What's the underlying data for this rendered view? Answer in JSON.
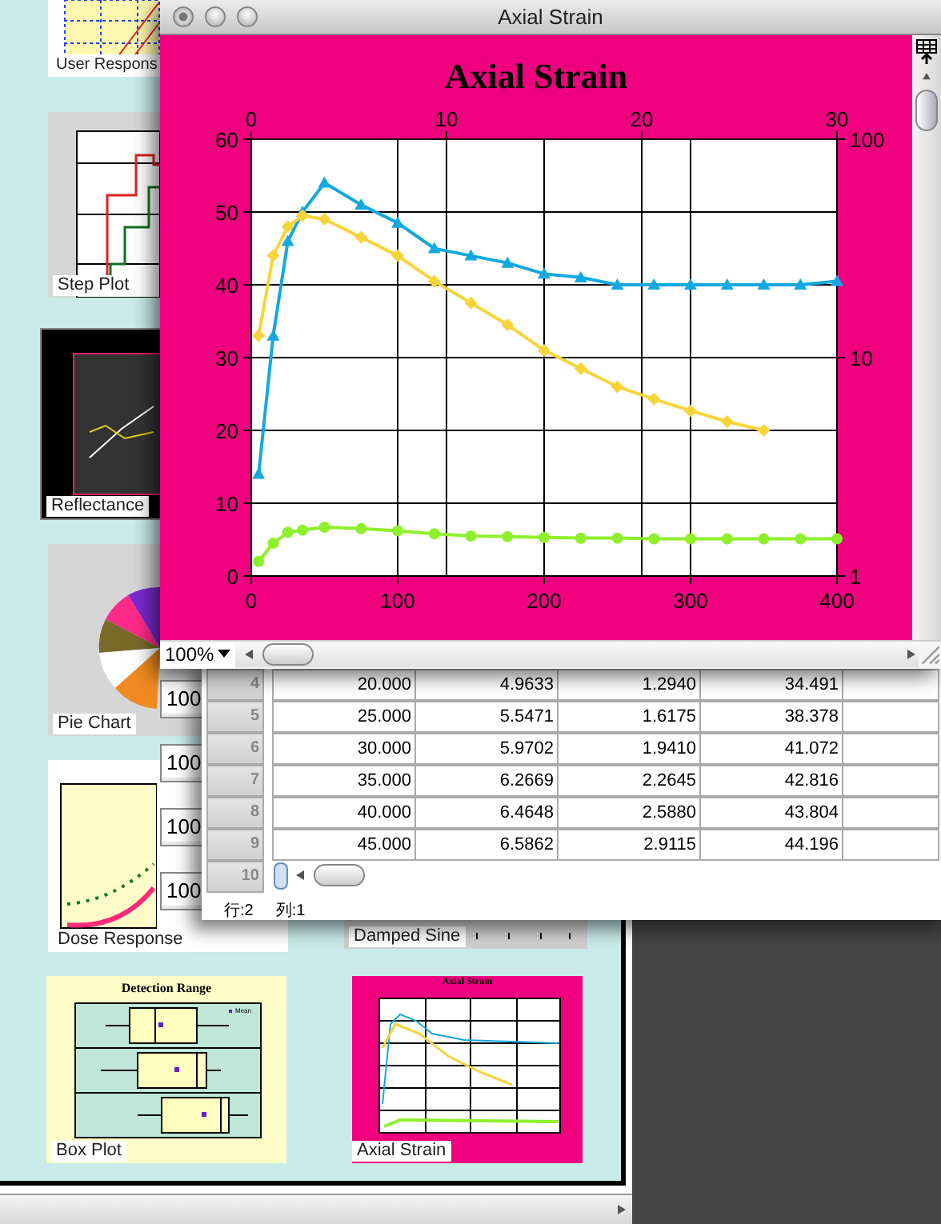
{
  "gallery": {
    "thumbnails": [
      {
        "kind": "grid",
        "label": "User Respons"
      },
      {
        "kind": "step",
        "label": "Step Plot"
      },
      {
        "kind": "dark",
        "label": "Reflectance"
      },
      {
        "kind": "pie",
        "label": "Pie Chart"
      },
      {
        "kind": "dose",
        "label": "Dose Response"
      },
      {
        "kind": "sine",
        "label": "Damped Sine"
      },
      {
        "kind": "box",
        "label": "Box Plot",
        "title": "Detection Range",
        "legend": "Mean"
      },
      {
        "kind": "strain",
        "label": "Axial Strain",
        "title": "Axial Strain"
      }
    ]
  },
  "stacked_windows": [
    {
      "zoom": "100"
    },
    {
      "zoom": "100"
    },
    {
      "zoom": "100"
    },
    {
      "zoom": "100"
    }
  ],
  "table_window": {
    "rows": [
      {
        "number": "4",
        "cells": [
          "20.000",
          "4.9633",
          "1.2940",
          "34.491"
        ]
      },
      {
        "number": "5",
        "cells": [
          "25.000",
          "5.5471",
          "1.6175",
          "38.378"
        ]
      },
      {
        "number": "6",
        "cells": [
          "30.000",
          "5.9702",
          "1.9410",
          "41.072"
        ]
      },
      {
        "number": "7",
        "cells": [
          "35.000",
          "6.2669",
          "2.2645",
          "42.816"
        ]
      },
      {
        "number": "8",
        "cells": [
          "40.000",
          "6.4648",
          "2.5880",
          "43.804"
        ]
      },
      {
        "number": "9",
        "cells": [
          "45.000",
          "6.5862",
          "2.9115",
          "44.196"
        ]
      },
      {
        "number": "10",
        "cells": []
      }
    ],
    "status": [
      "行:2",
      "列:1"
    ]
  },
  "chart_window": {
    "title": "Axial Strain",
    "zoom": "100%",
    "top_axis_labels": [
      "0",
      "10",
      "20",
      "30"
    ],
    "right_axis_labels": [
      "100",
      "10",
      "1"
    ],
    "chart_data": {
      "type": "line",
      "title": "Axial Strain",
      "grid": true,
      "x": [
        5,
        15,
        25,
        35,
        50,
        75,
        100,
        125,
        150,
        175,
        200,
        225,
        250,
        275,
        300,
        325,
        350,
        375,
        400
      ],
      "xlim": [
        0,
        400
      ],
      "ylim": [
        0,
        60
      ],
      "xticks": [
        0,
        100,
        200,
        300,
        400
      ],
      "yticks": [
        0,
        10,
        20,
        30,
        40,
        50,
        60
      ],
      "series": [
        {
          "color": "#12a8e0",
          "marker": "triangle",
          "values": [
            14,
            33,
            46,
            50,
            54,
            51,
            48.5,
            45,
            44,
            43,
            41.5,
            41,
            40,
            40,
            40,
            40,
            40,
            40,
            40.5
          ]
        },
        {
          "color": "#f7d43a",
          "marker": "diamond",
          "values": [
            33,
            44,
            48,
            49.5,
            49,
            46.5,
            44,
            40.5,
            37.5,
            34.5,
            31,
            28.5,
            26,
            24.3,
            22.7,
            21.2,
            20,
            null,
            null
          ]
        },
        {
          "color": "#8ef02a",
          "marker": "circle",
          "values": [
            2,
            4.5,
            6,
            6.3,
            6.7,
            6.5,
            6.2,
            5.8,
            5.5,
            5.4,
            5.3,
            5.2,
            5.2,
            5.1,
            5.1,
            5.1,
            5.1,
            5.1,
            5.1
          ]
        }
      ]
    }
  }
}
